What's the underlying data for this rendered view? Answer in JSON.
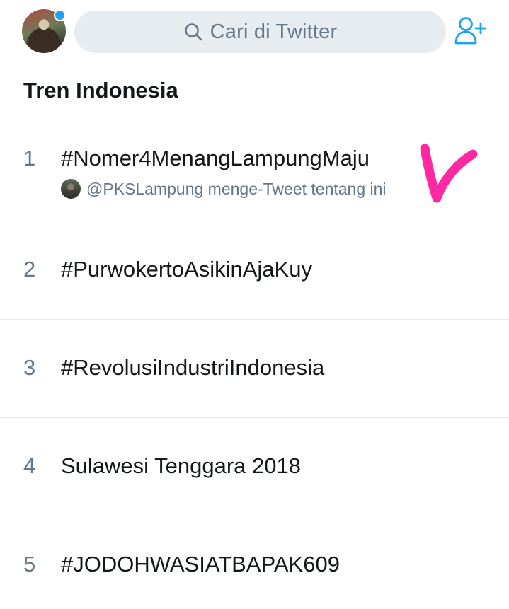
{
  "header": {
    "search_placeholder": "Cari di Twitter",
    "avatar_icon": "profile-avatar",
    "follow_icon": "add-user-icon",
    "accent_color": "#1da1f2"
  },
  "section": {
    "title": "Tren Indonesia"
  },
  "trends": [
    {
      "rank": "1",
      "name": "#Nomer4MenangLampungMaju",
      "context": "@PKSLampung menge-Tweet tentang ini"
    },
    {
      "rank": "2",
      "name": "#PurwokertoAsikinAjaKuy"
    },
    {
      "rank": "3",
      "name": "#RevolusiIndustriIndonesia"
    },
    {
      "rank": "4",
      "name": "Sulawesi Tenggara 2018"
    },
    {
      "rank": "5",
      "name": "#JODOHWASIATBAPAK609"
    }
  ],
  "annotation": {
    "color": "#ff2aa1",
    "icon": "handwritten-checkmark"
  }
}
